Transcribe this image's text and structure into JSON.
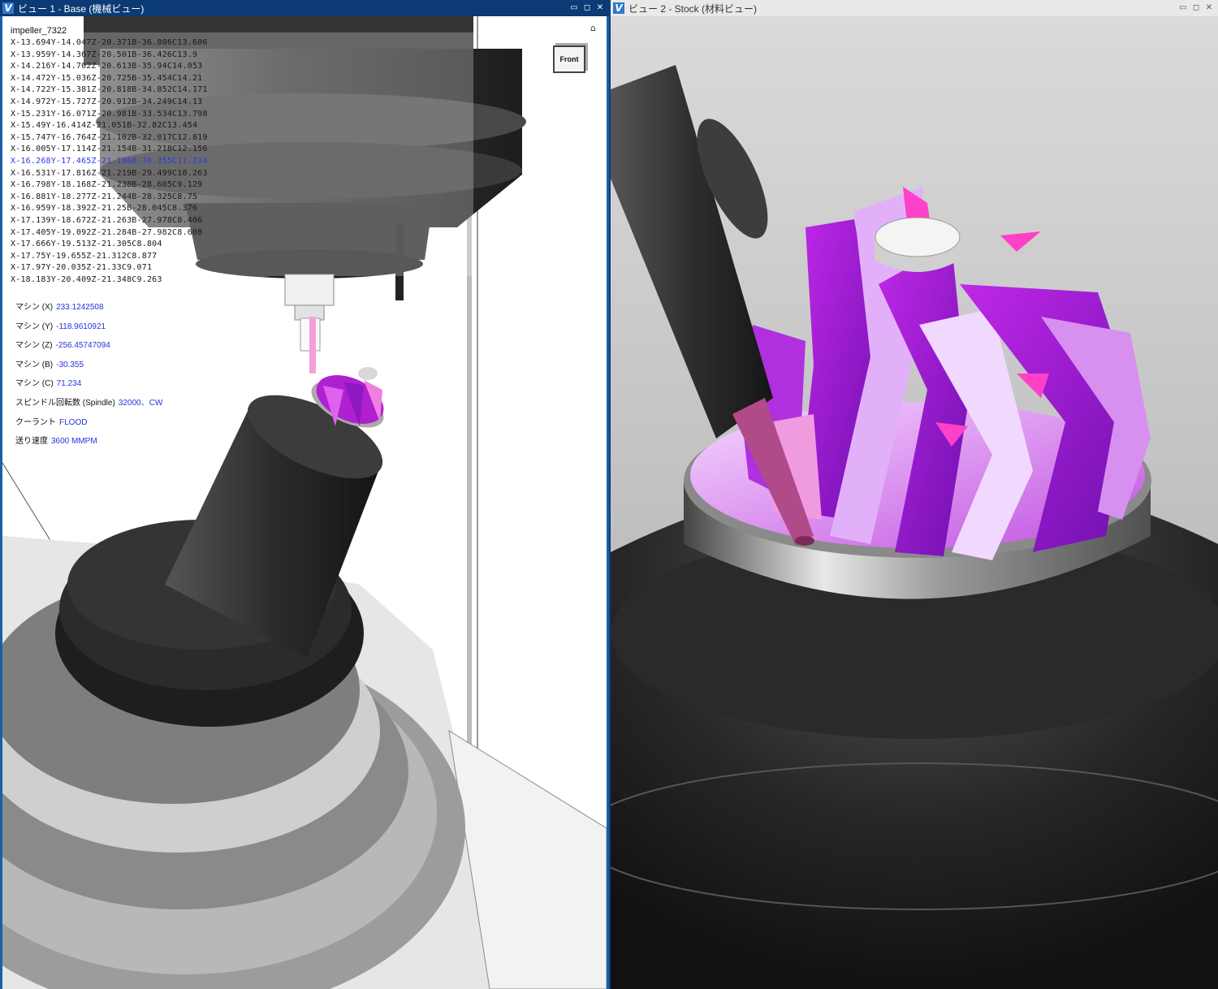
{
  "view1": {
    "title": "ビュー 1 - Base (機械ビュー)",
    "window_buttons": [
      "▭",
      "◻",
      "✕"
    ],
    "file_name": "impeller_7322",
    "viewcube_label": "Front",
    "home_icon": "home-icon",
    "gcode": [
      "X-13.694Y-14.047Z-20.371B-36.806C13.606",
      "X-13.959Y-14.367Z-20.501B-36.426C13.9",
      "X-14.216Y-14.702Z-20.613B-35.94C14.053",
      "X-14.472Y-15.036Z-20.725B-35.454C14.21",
      "X-14.722Y-15.381Z-20.818B-34.852C14.171",
      "X-14.972Y-15.727Z-20.912B-34.249C14.13",
      "X-15.231Y-16.071Z-20.981B-33.534C13.798",
      "X-15.49Y-16.414Z-21.051B-32.82C13.454",
      "X-15.747Y-16.764Z-21.102B-32.017C12.819",
      "X-16.005Y-17.114Z-21.154B-31.218C12.156",
      "X-16.268Y-17.465Z-21.186B-30.355C11.234",
      "X-16.531Y-17.816Z-21.219B-29.499C10.263",
      "X-16.798Y-18.168Z-21.238B-28.605C9.129",
      "X-16.881Y-18.277Z-21.244B-28.325C8.75",
      "X-16.959Y-18.392Z-21.25B-28.045C8.376",
      "X-17.139Y-18.672Z-21.263B-27.978C8.406",
      "X-17.405Y-19.092Z-21.284B-27.982C8.608",
      "X-17.666Y-19.513Z-21.305C8.804",
      "X-17.75Y-19.655Z-21.312C8.877",
      "X-17.97Y-20.035Z-21.33C9.071",
      "X-18.183Y-20.409Z-21.348C9.263"
    ],
    "active_line_index": 10,
    "readouts": [
      {
        "label": "マシン (X)",
        "value": "233.1242508"
      },
      {
        "label": "マシン (Y)",
        "value": "-118.9610921"
      },
      {
        "label": "マシン (Z)",
        "value": "-256.45747094"
      },
      {
        "label": "マシン (B)",
        "value": "-30.355"
      },
      {
        "label": "マシン (C)",
        "value": "71.234"
      },
      {
        "label": "スピンドル回転数 (Spindle)",
        "value": "32000、CW"
      },
      {
        "label": "クーラント",
        "value": "FLOOD"
      },
      {
        "label": "送り速度",
        "value": "3600 MMPM"
      }
    ]
  },
  "view2": {
    "title": "ビュー 2 - Stock (材料ビュー)",
    "window_buttons": [
      "▭",
      "◻",
      "✕"
    ]
  },
  "colors": {
    "titlebar_active": "#0b3a74",
    "titlebar_inactive": "#e9e9e9",
    "active_gcode": "#2a38e8",
    "readout_value": "#2233dd",
    "impeller_magenta": "#c020e0",
    "impeller_pink": "#f040c0"
  }
}
